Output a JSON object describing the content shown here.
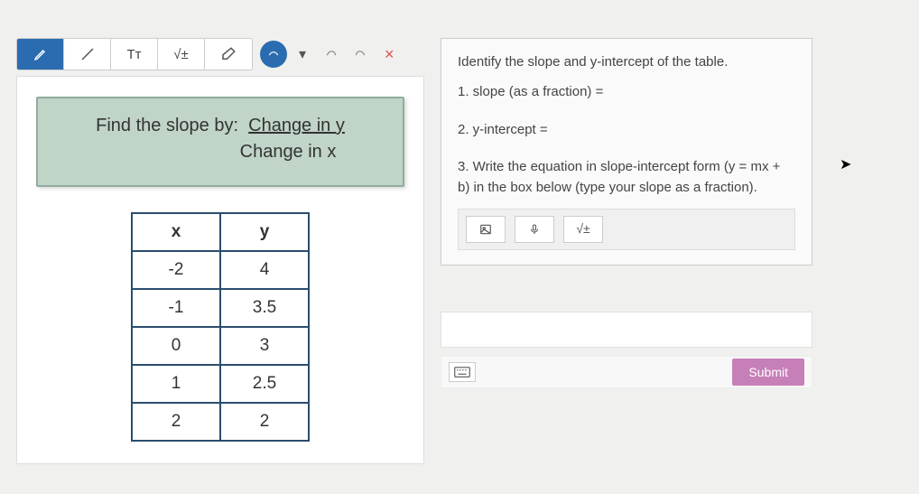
{
  "toolbar": {
    "text_tool": "Tᴛ",
    "math_tool": "√±"
  },
  "hint": {
    "prefix": "Find the slope by:",
    "numerator": "Change in y",
    "denominator": "Change in x"
  },
  "table": {
    "headers": {
      "x": "x",
      "y": "y"
    },
    "rows": [
      {
        "x": "-2",
        "y": "4"
      },
      {
        "x": "-1",
        "y": "3.5"
      },
      {
        "x": "0",
        "y": "3"
      },
      {
        "x": "1",
        "y": "2.5"
      },
      {
        "x": "2",
        "y": "2"
      }
    ]
  },
  "question": {
    "intro": "Identify the slope and y-intercept of the table.",
    "q1": "1. slope (as a fraction) =",
    "q2": "2. y-intercept =",
    "q3": "3. Write the equation in slope-intercept form (y = mx + b) in the box below (type your slope as a fraction).",
    "math_tool": "√±"
  },
  "submit": {
    "label": "Submit"
  }
}
